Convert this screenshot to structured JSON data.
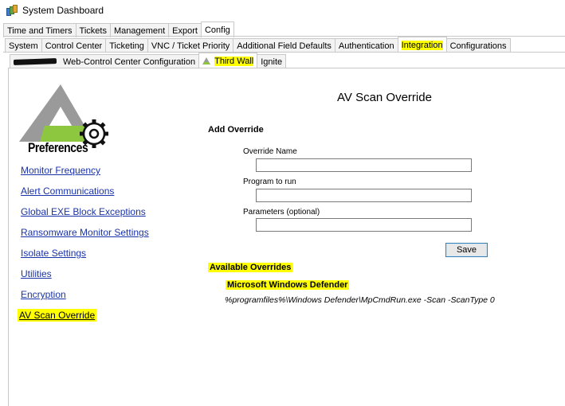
{
  "window": {
    "title": "System Dashboard"
  },
  "tabs_level1": [
    "Time and Timers",
    "Tickets",
    "Management",
    "Export",
    "Config"
  ],
  "tabs_level2": [
    "System",
    "Control Center",
    "Ticketing",
    "VNC / Ticket Priority",
    "Additional Field Defaults",
    "Authentication",
    "Integration",
    "Configurations"
  ],
  "tabs_level3": [
    "Web-Control Center Configuration",
    "Third Wall",
    "Ignite"
  ],
  "logo": {
    "text": "Preferences"
  },
  "sidebar": {
    "items": [
      "Monitor Frequency",
      "Alert Communications",
      "Global EXE Block Exceptions",
      "Ransomware Monitor Settings",
      "Isolate Settings",
      "Utilities",
      "Encryption",
      "AV Scan Override"
    ]
  },
  "main": {
    "title": "AV Scan Override",
    "add_title": "Add Override",
    "fields": [
      {
        "label": "Override Name",
        "value": ""
      },
      {
        "label": "Program to run",
        "value": ""
      },
      {
        "label": "Parameters (optional)",
        "value": ""
      }
    ],
    "save_label": "Save",
    "available_title": "Available Overrides",
    "overrides": [
      {
        "name": "Microsoft Windows Defender",
        "command": "%programfiles%\\Windows Defender\\MpCmdRun.exe -Scan -ScanType 0"
      }
    ]
  },
  "colors": {
    "highlight": "#ffff00",
    "link": "#1a33a8",
    "logo_gray": "#999999",
    "logo_green": "#8dc63f"
  }
}
